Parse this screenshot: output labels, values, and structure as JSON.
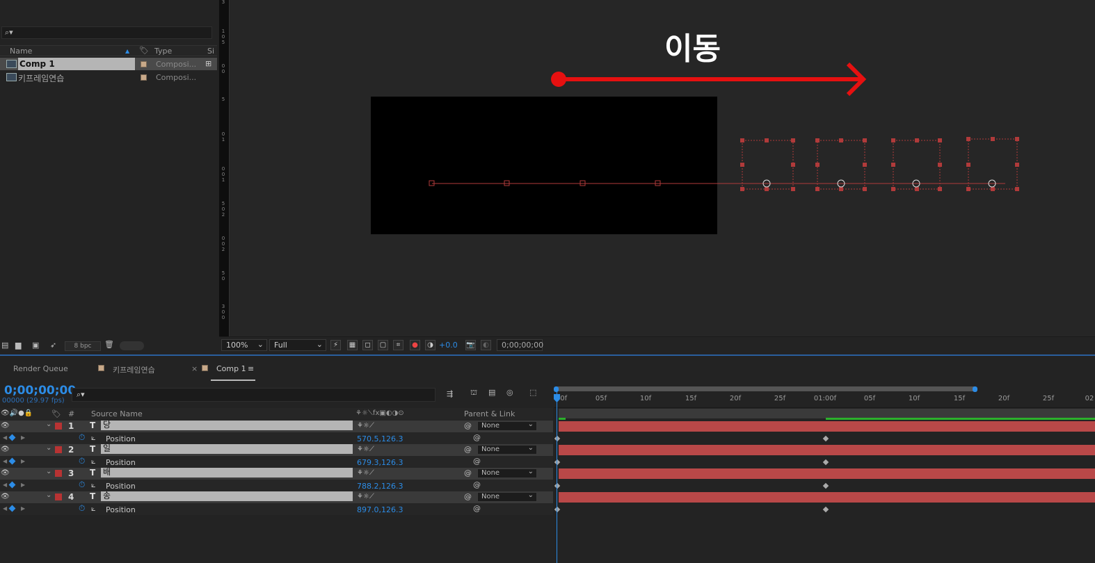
{
  "project": {
    "search_placeholder": "⌕▾",
    "columns": {
      "name": "Name",
      "type": "Type",
      "size": "Si"
    },
    "items": [
      {
        "name": "Comp 1",
        "type": "Composi..."
      },
      {
        "name": "키프레임연습",
        "type": "Composi..."
      }
    ],
    "bpc": "8 bpc"
  },
  "viewer": {
    "annotation_text": "이동",
    "annotation_color": "#e61010",
    "ruler_labels": [
      "3",
      "1",
      "0",
      "5",
      "0",
      "0",
      "5",
      "0",
      "1",
      "0",
      "0",
      "1",
      "5",
      "0",
      "2",
      "0",
      "0",
      "2",
      "5",
      "0",
      "3",
      "0",
      "0"
    ],
    "zoom": "100%",
    "resolution": "Full",
    "exposure": "+0.0",
    "timecode": "0;00;00;00"
  },
  "tabs": [
    {
      "label": "Render Queue"
    },
    {
      "label": "키프레임연습"
    },
    {
      "label": "Comp 1"
    }
  ],
  "timeline": {
    "timecode": "0;00;00;00",
    "fps": "00000 (29.97 fps)",
    "headers": {
      "num": "#",
      "source_name": "Source Name",
      "parent": "Parent & Link"
    },
    "layers": [
      {
        "num": "1",
        "name": "당",
        "prop": "Position",
        "value": "570.5,126.3",
        "parent": "None"
      },
      {
        "num": "2",
        "name": "일",
        "prop": "Position",
        "value": "679.3,126.3",
        "parent": "None"
      },
      {
        "num": "3",
        "name": "배",
        "prop": "Position",
        "value": "788.2,126.3",
        "parent": "None"
      },
      {
        "num": "4",
        "name": "송",
        "prop": "Position",
        "value": "897.0,126.3",
        "parent": "None"
      }
    ],
    "ruler_ticks": [
      "00f",
      "05f",
      "10f",
      "15f",
      "20f",
      "25f",
      "01:00f",
      "05f",
      "10f",
      "15f",
      "20f",
      "25f",
      "02"
    ],
    "layer_bar_color": "#b94848",
    "accent_color": "#2c8ce6"
  }
}
